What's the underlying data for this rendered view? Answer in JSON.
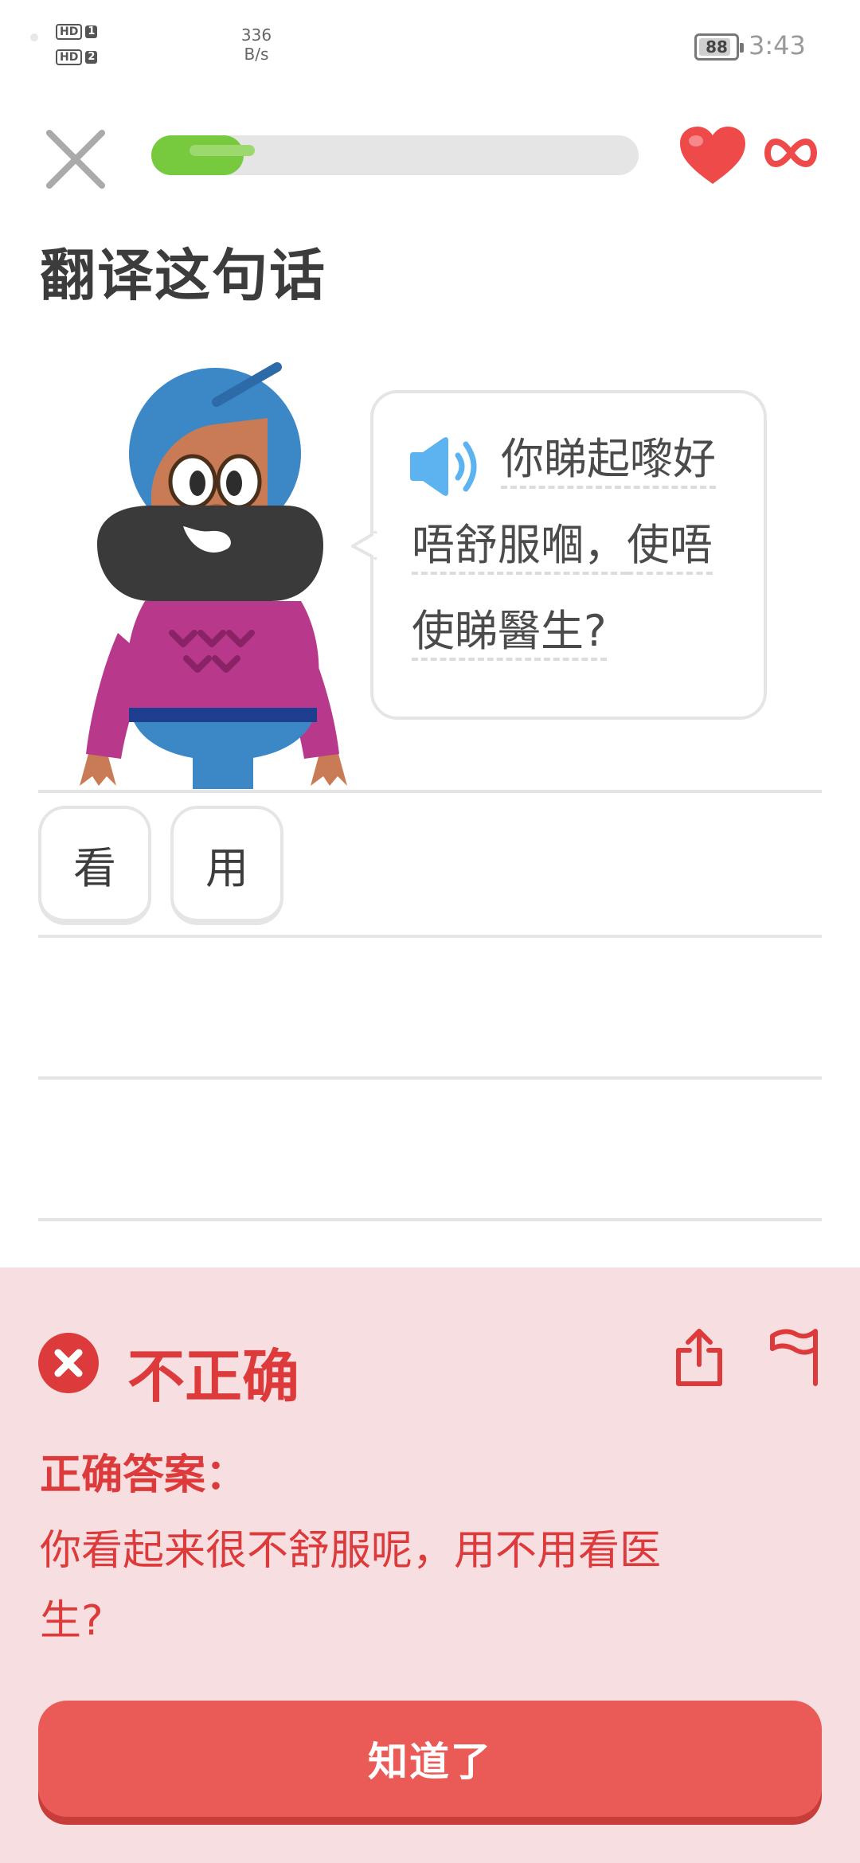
{
  "status_bar": {
    "sim1_hd": "HD",
    "sim1_num": "1",
    "sim2_hd": "HD",
    "sim2_num": "2",
    "speed_value": "336",
    "speed_unit": "B/s",
    "battery": "88",
    "battery_fraction": 0.88,
    "time": "3:43"
  },
  "lesson": {
    "progress_fraction": 0.19,
    "hearts": "∞",
    "title": "翻译这句话"
  },
  "prompt": {
    "line1": "你睇起嚟好",
    "line2_a": "唔舒服嗰，",
    "line2_b": "使唔",
    "line3": "使睇醫生?"
  },
  "answer_tiles": [
    "看",
    "用"
  ],
  "feedback": {
    "title": "不正确",
    "label": "正确答案：",
    "answer": "你看起来很不舒服呢，用不用看医生?",
    "continue_label": "知道了"
  },
  "colors": {
    "green": "#77c93d",
    "red": "#dd3b3b",
    "feedback_bg": "#f7dfe1",
    "button": "#ea5b57"
  }
}
